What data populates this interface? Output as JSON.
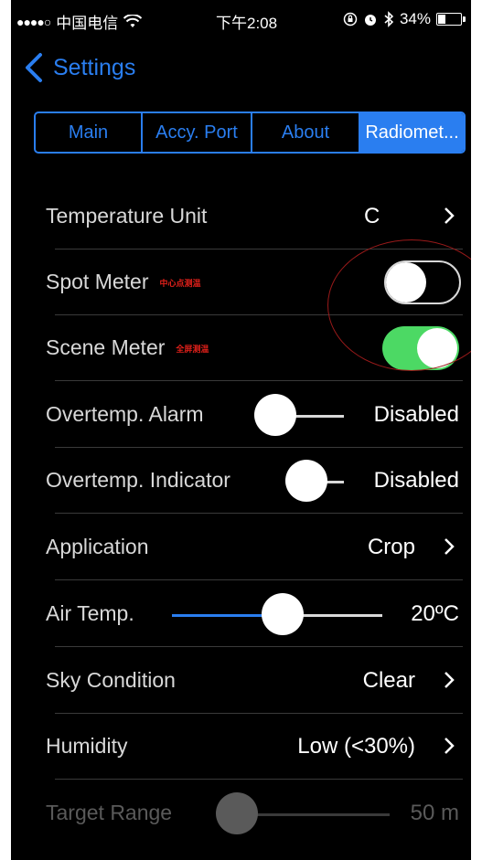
{
  "status_bar": {
    "signal": "●●●●○",
    "carrier": "中国电信",
    "time": "下午2:08",
    "battery_percent": "34%",
    "battery_level": 0.34
  },
  "nav": {
    "back_label": "Settings"
  },
  "tabs": [
    {
      "label": "Main",
      "active": false
    },
    {
      "label": "Accy. Port",
      "active": false
    },
    {
      "label": "About",
      "active": false
    },
    {
      "label": "Radiomet...",
      "active": true
    }
  ],
  "settings": {
    "temperature_unit": {
      "label": "Temperature Unit",
      "value": "C"
    },
    "spot_meter": {
      "label": "Spot Meter",
      "note": "中心点测温",
      "enabled": false
    },
    "scene_meter": {
      "label": "Scene Meter",
      "note": "全屏测温",
      "enabled": true
    },
    "overtemp_alarm": {
      "label": "Overtemp. Alarm",
      "value": "Disabled",
      "slider_level": 0
    },
    "overtemp_indicator": {
      "label": "Overtemp. Indicator",
      "value": "Disabled",
      "slider_level": 0
    },
    "application": {
      "label": "Application",
      "value": "Crop"
    },
    "air_temp": {
      "label": "Air Temp.",
      "value": "20ºC",
      "slider_level": 0.5
    },
    "sky_condition": {
      "label": "Sky Condition",
      "value": "Clear"
    },
    "humidity": {
      "label": "Humidity",
      "value": "Low (<30%)"
    },
    "target_range": {
      "label": "Target Range",
      "value": "50 m",
      "slider_level": 0,
      "enabled": false
    }
  },
  "colors": {
    "accent": "#2a7ef0",
    "toggle_on": "#4cd964",
    "annotation": "#e0201a"
  }
}
